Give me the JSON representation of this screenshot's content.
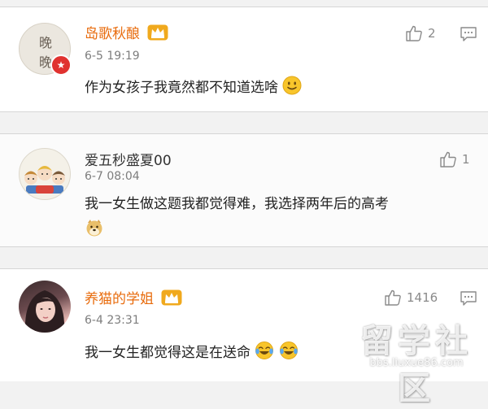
{
  "comments": [
    {
      "username": "岛歌秋酿",
      "vip": true,
      "avatar_text": [
        "晚",
        "晚"
      ],
      "time": "6-5 19:19",
      "text": "作为女孩子我竟然都不知道选啥",
      "likes": "2",
      "emoji": "slight-smile-emoji"
    },
    {
      "username": "爱五秒盛夏00",
      "vip": false,
      "time": "6-7 08:04",
      "text": "我一女生做这题我都觉得难，我选择两年后的高考",
      "likes": "1",
      "emoji": "doge-emoji"
    },
    {
      "username": "养猫的学姐",
      "vip": true,
      "time": "6-4 23:31",
      "text": "我一女生都觉得这是在送命",
      "likes": "1416",
      "emoji": "crying-laughing-emoji"
    }
  ],
  "watermark": {
    "title": "留学社区",
    "url": "bbs.liuxue86.com"
  },
  "colors": {
    "vip_name": "#e86b0c",
    "normal_name": "#333333",
    "badge_red": "#e0322f",
    "crown_gold": "#f0a91d"
  }
}
